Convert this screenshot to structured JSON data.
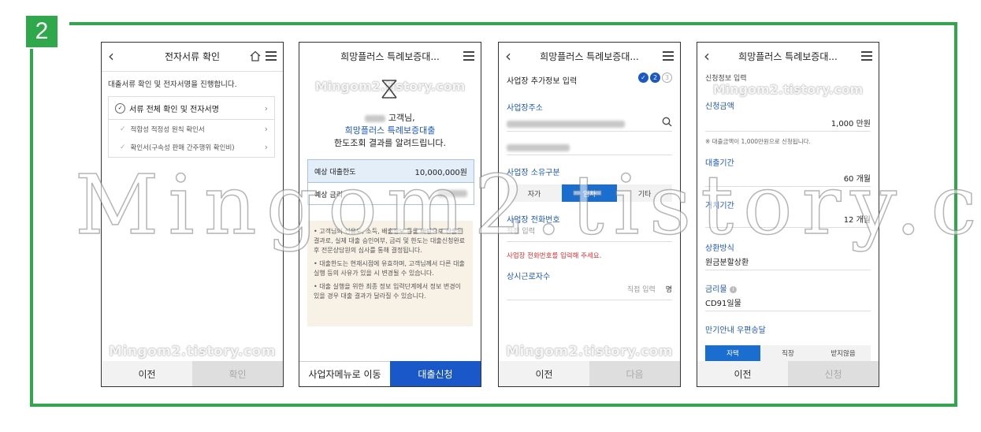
{
  "step_number": "2",
  "watermark": "Mingom2.tistory.com",
  "colors": {
    "frame_green": "#2ea84a",
    "primary_blue": "#1a57c8"
  },
  "screen1": {
    "title": "전자서류 확인",
    "intro": "대출서류 확인 및 전자서명을 진행합니다.",
    "main_item": "서류 전체 확인 및 전자서명",
    "sub_items": [
      "적합성 적정성 원칙 확인서",
      "확인서(구속성 판매 간주행위 확인비)"
    ],
    "footer_prev": "이전",
    "footer_confirm": "확인"
  },
  "screen2": {
    "title": "희망플러스 특례보증대...",
    "greeting_suffix": "고객님,",
    "product": "희망플러스 특례보증대출",
    "result_text": "한도조회 결과를 알려드립니다.",
    "limit_label": "예상 대출한도",
    "limit_value": "10,000,000원",
    "rate_label": "예상 금리",
    "notes": [
      "고객님의 신용도, 소득, 배출정보 등을 바탕으로 산출된 결과로, 실제 대출 승인여부, 금리 및 한도는 대출신청완료 후 전문상담원의 심사를 통해 결정됩니다.",
      "대출한도는 현재시점에 유효하며, 고객님께서 다른 대출실행 등의 사유가 있을 시 변경될 수 있습니다.",
      "대출 실행을 위한 최종 정보 입력단계에서 정보 변경이 있을 경우 대출 결과가 달라질 수 있습니다."
    ],
    "footer_left": "사업자메뉴로 이동",
    "footer_right": "대출신청"
  },
  "screen3": {
    "title": "희망플러스 특례보증대...",
    "section_title": "사업장 추가정보 입력",
    "steps": [
      "✓",
      "2",
      "3"
    ],
    "address_label": "사업장주소",
    "ownership_label": "사업장 소유구분",
    "ownership_options": [
      "자가",
      "임차",
      "기타"
    ],
    "ownership_selected": "임차",
    "phone_label": "사업장 전화번호",
    "phone_placeholder": "직접 입력",
    "phone_error": "사업장 전화번호를 입력해 주세요.",
    "employees_label": "상시근로자수",
    "employees_placeholder": "직접 입력",
    "employees_unit": "명",
    "footer_prev": "이전",
    "footer_next": "다음"
  },
  "screen4": {
    "title": "희망플러스 특례보증대...",
    "section_title": "신청정보 입력",
    "amount_label": "신청금액",
    "amount_value": "1,000 만원",
    "amount_note": "※ 대출금액이 1,000만원으로 신청됩니다.",
    "period_label": "대출기간",
    "period_value": "60 개월",
    "grace_label": "거치기간",
    "grace_value": "12 개월",
    "repay_label": "상환방식",
    "repay_value": "원금분할상환",
    "rate_label": "금리물",
    "rate_value": "CD91일물",
    "mail_label": "만기안내 우편송달",
    "mail_options": [
      "자택",
      "직장",
      "받지않음"
    ],
    "mail_selected": "자택",
    "footer_prev": "이전",
    "footer_apply": "신청"
  }
}
